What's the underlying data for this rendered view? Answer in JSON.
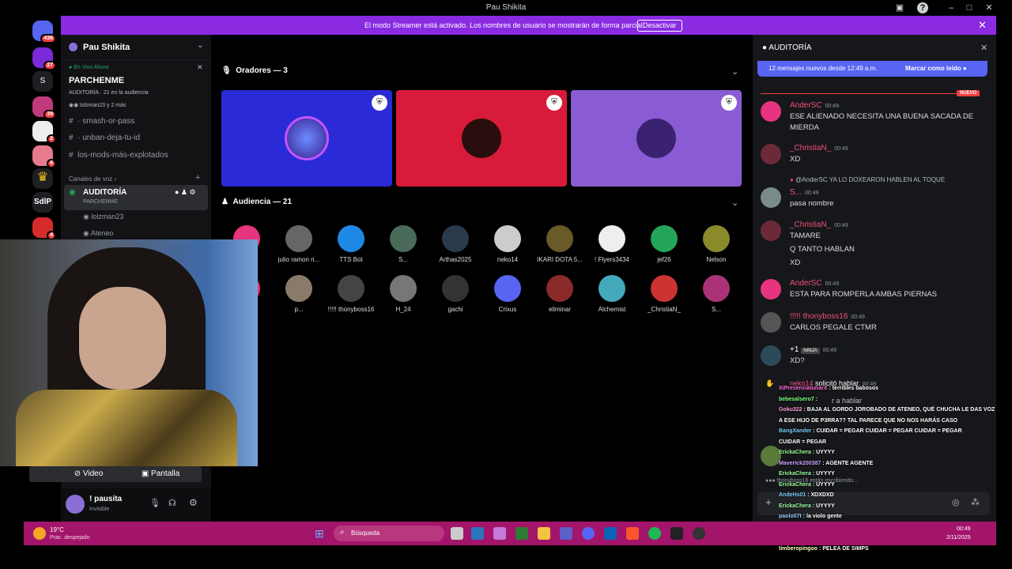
{
  "window": {
    "title": "Pau Shikita"
  },
  "banner": {
    "text": "El modo Streamer está activado. Los nombres de usuario se mostrarán de forma parcial.",
    "button": "Desactivar"
  },
  "rail": {
    "badges": [
      "436",
      "27",
      "39",
      "2",
      "6",
      "4"
    ],
    "labels": [
      "S",
      "SdlP"
    ]
  },
  "server": {
    "name": "Pau Shikita"
  },
  "live": {
    "tag": "En Vivo Ahora",
    "event": "PARCHENME",
    "meta": "AUDITORÍA · 21 en la audiencia",
    "people": "lolzman23 y 2 más"
  },
  "channels": [
    "smash-or-pass",
    "unban-deja-tu-id",
    "los-mods-más-explotados"
  ],
  "voice": {
    "category": "Canales de voz",
    "channel": "AUDITORÍA",
    "topic": "PARCHENME",
    "members": [
      "lolzman23",
      "Ateneo"
    ]
  },
  "media": {
    "video": "Video",
    "screen": "Pantalla"
  },
  "user": {
    "name": "! pausita",
    "status": "Invisible"
  },
  "stage": {
    "speakers_title": "Oradores — 3",
    "audience_title": "Audiencia — 21"
  },
  "audience_row1": [
    "",
    "julio ramon ri...",
    "TTS Bot",
    "S...",
    "Arthas2025",
    "neko14",
    "IKARI DOTA 5...",
    "! Flyers3434",
    "jef26",
    "Nelson"
  ],
  "audience_row2": [
    "",
    "p...",
    "!!!!! thonyboss16",
    "H_24",
    "gachi",
    "Crixus",
    "eliminar",
    "Alchemist",
    "_ChristiaN_",
    "S..."
  ],
  "chat": {
    "title": "AUDITORÍA",
    "new_bar": "12 mensajes nuevos desde 12:49 a.m.",
    "mark_read": "Marcar como leído",
    "new_label": "NUEVO",
    "messages": [
      {
        "name": "AnderSC",
        "time": "00:49",
        "text": "ESE ALIENADO NECESITA UNA BUENA SACADA DE MIERDA"
      },
      {
        "name": "_ChristiaN_",
        "time": "00:49",
        "text": "XD"
      },
      {
        "reply": "@AnderSC YA LO DOXEARON HABLEN AL TOQUE",
        "name": "S...",
        "time": "00:49",
        "text": "pasa nombre"
      },
      {
        "name": "_ChristiaN_",
        "time": "00:49",
        "text": "TAMARE"
      },
      {
        "text": "Q TANTO HABLAN"
      },
      {
        "text": "XD"
      },
      {
        "name": "AnderSC",
        "time": "00:49",
        "text": "ESTA PARA ROMPERLA AMBAS PIERNAS"
      },
      {
        "name": "!!!!! thonyboss16",
        "time": "00:49",
        "text": "CARLOS PEGALE CTMR"
      },
      {
        "name": "+1",
        "tag": "NINJA",
        "time": "00:49",
        "text": "XD?"
      }
    ],
    "request": {
      "name": "neko14",
      "action": "solicitó hablar.",
      "time": "00:49",
      "sub": "r a hablar"
    },
    "typing": "thonyboss16 están escribiendo..."
  },
  "overlay": [
    {
      "user": "XiPresencialunarX",
      "text": ": terribles babosos",
      "color": "#ff6bd5"
    },
    {
      "user": "bebesalsero7",
      "text": ":",
      "color": "#7cff7c"
    },
    {
      "user": "Goku322",
      "text": ": BAJA AL GORDO JOROBADO DE ATENEO, QUÉ CHUCHA LE DAS VOZ",
      "color": "#ff9ed8"
    },
    {
      "user": "",
      "text": "A ESE HIJO DE P3RRA?? TAL PARECE QUE NO NOS HARÁS CASO",
      "color": "#ffffff"
    },
    {
      "user": "BangXander",
      "text": ": CUIDAR = PEGAR     CUIDAR = PEGAR     CUIDAR = PEGAR",
      "color": "#7cf"
    },
    {
      "user": "",
      "text": "CUIDAR = PEGAR",
      "color": "#ffffff"
    },
    {
      "user": "ErickaChera",
      "text": ": UYYYY",
      "color": "#9f9"
    },
    {
      "user": "Maverick200387",
      "text": ": AGENTE AGENTE",
      "color": "#c9a0ff"
    },
    {
      "user": "ErickaChera",
      "text": ": UYYYY",
      "color": "#9f9"
    },
    {
      "user": "ErickaChera",
      "text": ": UYYYY",
      "color": "#9f9"
    },
    {
      "user": "AndeHs01",
      "text": ": XDXDXD",
      "color": "#7cf"
    },
    {
      "user": "ErickaChera",
      "text": ": UYYYY",
      "color": "#9f9"
    },
    {
      "user": "paolo07t",
      "text": ": la violo gente",
      "color": "#9cf"
    },
    {
      "user": "BangXander",
      "text": ": CUIDAR = PEGAR     CUIDAR = PEGAR     CUIDAR = PEGAR",
      "color": "#7cf"
    },
    {
      "user": "ErickaChera",
      "text": ": UYYYY",
      "color": "#9f9"
    },
    {
      "user": "timberopingoo",
      "text": ": PELEA DE SIMPS",
      "color": "#ffb"
    }
  ],
  "taskbar": {
    "temp": "19°C",
    "weather": "Prac. despejado",
    "search": "Búsqueda",
    "time": "00:49",
    "date": "2/11/2025"
  }
}
